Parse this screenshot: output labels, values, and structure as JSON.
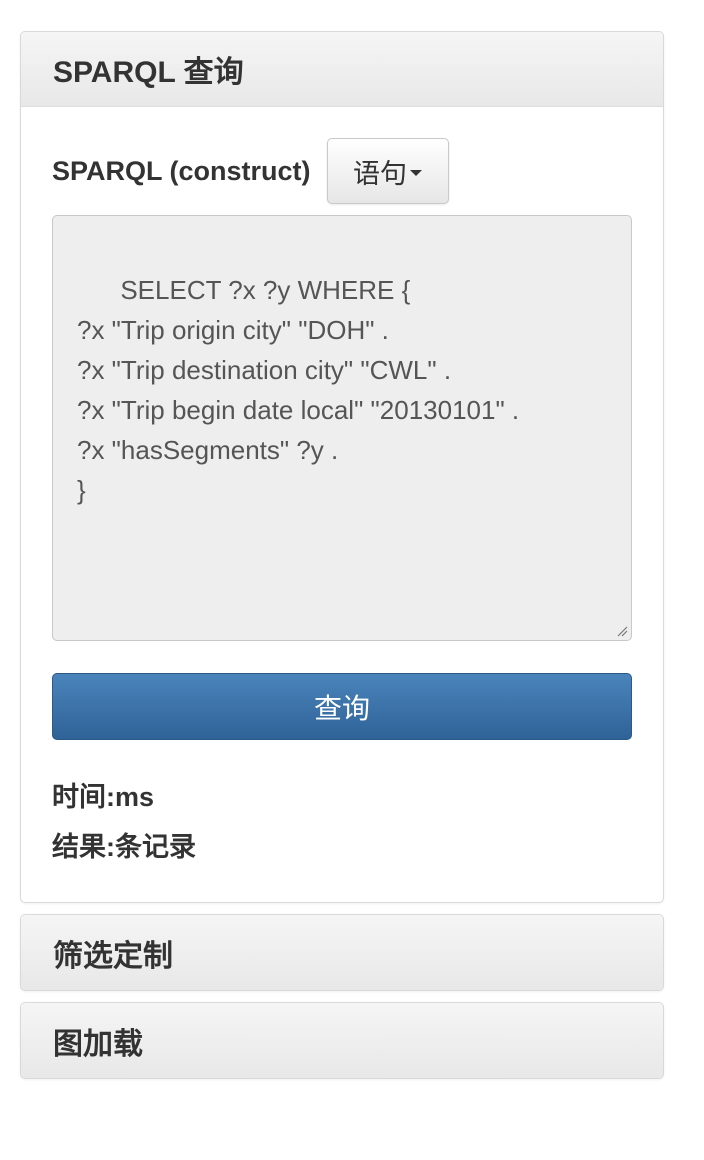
{
  "sparql_panel": {
    "title": "SPARQL 查询",
    "label": "SPARQL (construct)",
    "statement_button": "语句",
    "query_text": "SELECT ?x ?y WHERE {\n?x \"Trip origin city\" \"DOH\" .\n?x \"Trip destination city\" \"CWL\" .\n?x \"Trip begin date local\" \"20130101\" .\n?x \"hasSegments\" ?y .\n}",
    "query_button": "查询",
    "time_label": "时间:ms",
    "result_label": "结果:条记录"
  },
  "filter_panel": {
    "title": "筛选定制"
  },
  "graph_panel": {
    "title": "图加载"
  },
  "colors": {
    "primary_button": "#3a72a8",
    "textarea_bg": "#eeeeee",
    "panel_heading_bg": "#ececec"
  },
  "icons": {
    "dropdown": "caret-down-icon",
    "resize": "resize-grip-icon"
  }
}
